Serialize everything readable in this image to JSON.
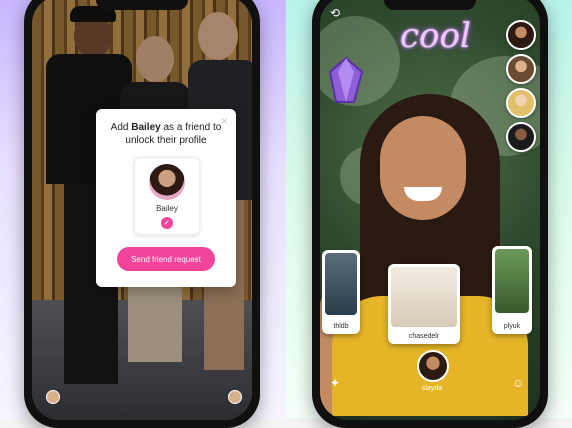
{
  "left_phone": {
    "popup": {
      "title_prefix": "Add ",
      "title_name": "Bailey",
      "title_suffix": " as a friend to unlock their profile",
      "close_icon": "×",
      "profile_name": "Bailey",
      "check_icon": "✓",
      "button_label": "Send friend request"
    }
  },
  "right_phone": {
    "sticker_text": "cool",
    "tiles": [
      {
        "label": "thldb"
      },
      {
        "label": "chasedelr"
      },
      {
        "label": "plyuk"
      }
    ],
    "bottom_user": "slayda",
    "icons": {
      "switch_camera": "⟲",
      "wand": "✦",
      "profile_ghost": "☺"
    }
  },
  "colors": {
    "accent_pink": "#f0459a",
    "left_bg": "#c9b6ff",
    "right_bg": "#b8f3ea"
  }
}
